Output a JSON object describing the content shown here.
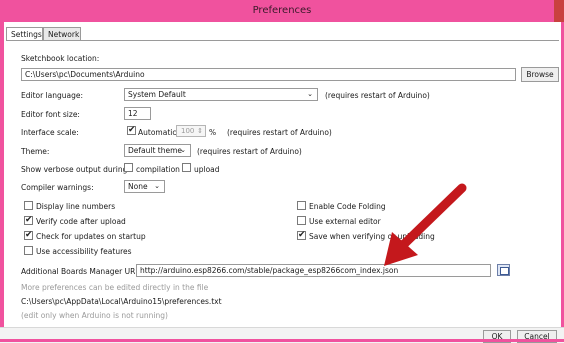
{
  "window": {
    "title": "Preferences"
  },
  "tabs": [
    "Settings",
    "Network"
  ],
  "sketchbook": {
    "label": "Sketchbook location:",
    "value": "C:\\Users\\pc\\Documents\\Arduino",
    "browse_label": "Browse"
  },
  "editor_language": {
    "label": "Editor language:",
    "value": "System Default",
    "note": "(requires restart of Arduino)"
  },
  "editor_font_size": {
    "label": "Editor font size:",
    "value": "12"
  },
  "interface_scale": {
    "label": "Interface scale:",
    "automatic_label": "Automatic",
    "automatic_checked": true,
    "value": "100",
    "unit": "%",
    "note": "(requires restart of Arduino)"
  },
  "theme": {
    "label": "Theme:",
    "value": "Default theme",
    "note": "(requires restart of Arduino)"
  },
  "verbose": {
    "label": "Show verbose output during:",
    "compilation_label": "compilation",
    "compilation_checked": false,
    "upload_label": "upload",
    "upload_checked": false
  },
  "compiler_warnings": {
    "label": "Compiler warnings:",
    "value": "None"
  },
  "options_left": [
    {
      "label": "Display line numbers",
      "checked": false
    },
    {
      "label": "Verify code after upload",
      "checked": true
    },
    {
      "label": "Check for updates on startup",
      "checked": true
    },
    {
      "label": "Use accessibility features",
      "checked": false
    }
  ],
  "options_right": [
    {
      "label": "Enable Code Folding",
      "checked": false
    },
    {
      "label": "Use external editor",
      "checked": false
    },
    {
      "label": "Save when verifying or uploading",
      "checked": true
    }
  ],
  "boards_manager": {
    "label": "Additional Boards Manager URLs:",
    "value": "http://arduino.esp8266.com/stable/package_esp8266com_index.json"
  },
  "more_prefs_text": "More preferences can be edited directly in the file",
  "prefs_path": "C:\\Users\\pc\\AppData\\Local\\Arduino15\\preferences.txt",
  "edit_note": "(edit only when Arduino is not running)",
  "buttons": {
    "ok": "OK",
    "cancel": "Cancel"
  },
  "colors": {
    "titlebar": "#f0529e",
    "arrow": "#c4181c"
  },
  "icons": {
    "dropdown": "chevron-down-icon",
    "checkmark": "check-icon",
    "url-editor": "window-icon",
    "annotation": "red-arrow-icon"
  }
}
